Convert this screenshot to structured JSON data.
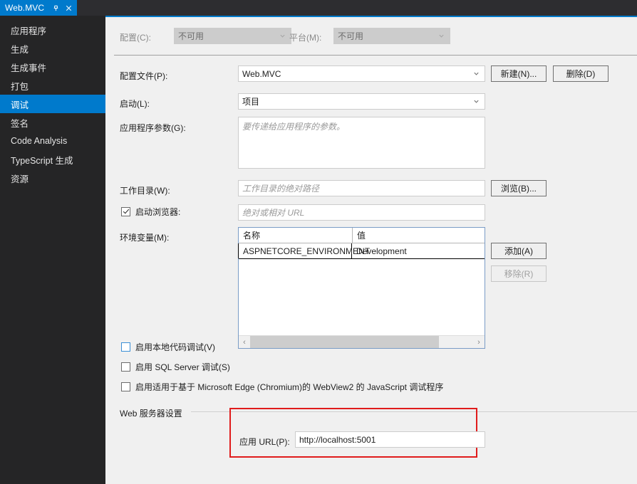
{
  "tab": {
    "title": "Web.MVC",
    "pin_icon": "pin-icon",
    "close_icon": "close-icon"
  },
  "sidebar": {
    "items": [
      {
        "label": "应用程序",
        "selected": false
      },
      {
        "label": "生成",
        "selected": false
      },
      {
        "label": "生成事件",
        "selected": false
      },
      {
        "label": "打包",
        "selected": false
      },
      {
        "label": "调试",
        "selected": true
      },
      {
        "label": "签名",
        "selected": false
      },
      {
        "label": "Code Analysis",
        "selected": false
      },
      {
        "label": "TypeScript 生成",
        "selected": false
      },
      {
        "label": "资源",
        "selected": false
      }
    ]
  },
  "config_row": {
    "configuration_label": "配置(C):",
    "configuration_value": "不可用",
    "platform_label": "平台(M):",
    "platform_value": "不可用"
  },
  "form": {
    "profile_label": "配置文件(P):",
    "profile_value": "Web.MVC",
    "new_button": "新建(N)...",
    "delete_button": "删除(D)",
    "launch_label": "启动(L):",
    "launch_value": "项目",
    "app_args_label": "应用程序参数(G):",
    "app_args_placeholder": "要传递给应用程序的参数。",
    "working_dir_label": "工作目录(W):",
    "working_dir_placeholder": "工作目录的绝对路径",
    "browse_button": "浏览(B)...",
    "launch_browser_label": "启动浏览器:",
    "launch_browser_checked": true,
    "browser_url_placeholder": "绝对或相对 URL",
    "env_vars_label": "环境变量(M):",
    "add_button": "添加(A)",
    "remove_button": "移除(R)"
  },
  "env_table": {
    "columns": [
      "名称",
      "值"
    ],
    "rows": [
      {
        "name": "ASPNETCORE_ENVIRONMENT",
        "value": "Development"
      }
    ],
    "scroll_left_arrow": "‹",
    "scroll_right_arrow": "›"
  },
  "options": [
    {
      "label": "启用本地代码调试(V)",
      "checked": false,
      "focused": true
    },
    {
      "label": "启用 SQL Server 调试(S)",
      "checked": false,
      "focused": false
    },
    {
      "label": "启用适用于基于 Microsoft Edge (Chromium)的 WebView2 的 JavaScript 调试程序",
      "checked": false,
      "focused": false
    }
  ],
  "web_server": {
    "section_label": "Web 服务器设置",
    "app_url_label": "应用 URL(P):",
    "app_url_value": "http://localhost:5001"
  },
  "colors": {
    "accent": "#007acc",
    "sidebar_bg": "#252526",
    "tabstrip_bg": "#2d2d30",
    "content_bg": "#f0f0f0",
    "highlight_red": "#e01b1b"
  }
}
